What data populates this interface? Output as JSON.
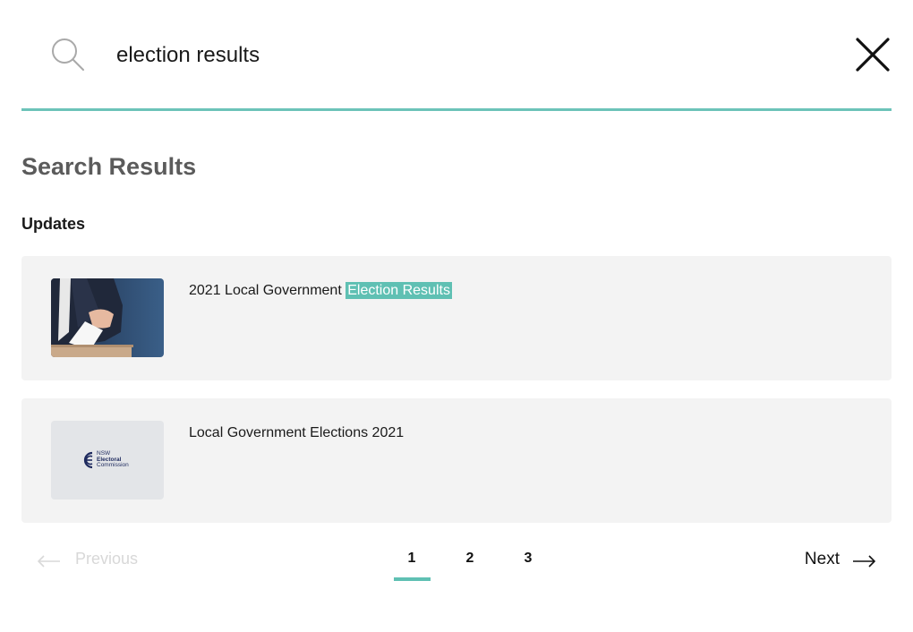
{
  "search": {
    "value": "election results",
    "placeholder": ""
  },
  "header": {
    "title": "Search Results",
    "section": "Updates"
  },
  "results": [
    {
      "title_before": "2021 Local Government ",
      "title_highlight": "Election Results",
      "thumbnail": "ballot-box-photo"
    },
    {
      "title_before": "Local Government Elections 2021",
      "title_highlight": "",
      "thumbnail": "nsw-electoral-commission-logo",
      "logo_lines": [
        "NSW",
        "Electoral",
        "Commission"
      ]
    }
  ],
  "pagination": {
    "previous_label": "Previous",
    "next_label": "Next",
    "pages": [
      "1",
      "2",
      "3"
    ],
    "current_page": "1"
  },
  "colors": {
    "accent": "#5fc0b3",
    "card_bg": "#f3f3f3",
    "title_gray": "#5b5b5b",
    "disabled": "#d8d8d8"
  },
  "icons": {
    "search": "search-icon",
    "close": "close-icon",
    "prev": "arrow-left-icon",
    "next": "arrow-right-icon"
  }
}
